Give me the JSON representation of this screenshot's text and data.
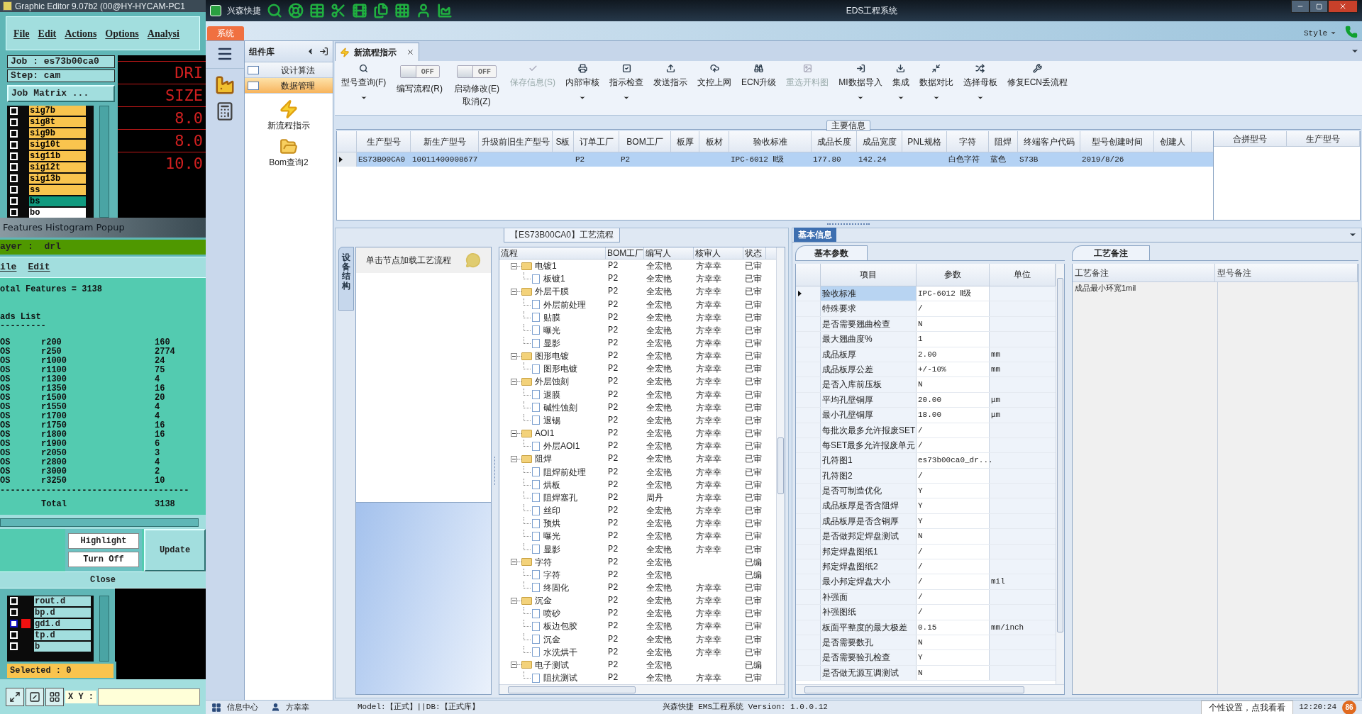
{
  "cam_editor": {
    "title": "Graphic Editor 9.07b2 (00@HY-HYCAM-PC1",
    "menu": [
      "File",
      "Edit",
      "Actions",
      "Options",
      "Analysi"
    ],
    "job": "Job : es73b00ca0",
    "step": "Step: cam",
    "job_matrix_button": "Job Matrix ...",
    "layers": [
      {
        "name": "sig7b",
        "color": "#f9c44e",
        "checked": false
      },
      {
        "name": "sig8t",
        "color": "#f9c44e",
        "checked": false
      },
      {
        "name": "sig9b",
        "color": "#f9c44e",
        "checked": false
      },
      {
        "name": "sig10t",
        "color": "#f9c44e",
        "checked": false
      },
      {
        "name": "sig11b",
        "color": "#f9c44e",
        "checked": false
      },
      {
        "name": "sig12t",
        "color": "#f9c44e",
        "checked": false
      },
      {
        "name": "sig13b",
        "color": "#f9c44e",
        "checked": false
      },
      {
        "name": "ss",
        "color": "#f9c44e",
        "checked": false
      },
      {
        "name": "bs",
        "color": "#119a7f",
        "checked": false
      },
      {
        "name": "bo",
        "color": "#ffffff",
        "checked": false
      }
    ],
    "readouts": [
      "DRI",
      "SIZE",
      "8.0",
      "8.0",
      "10.0"
    ]
  },
  "histogram_popup": {
    "title": "Features Histogram Popup",
    "layer": "ayer :  drl",
    "menu": [
      "ile",
      "Edit"
    ],
    "total_features": "otal Features = 3138",
    "list_title": "ads List",
    "rule": "---------",
    "rows": [
      [
        "OS",
        "r200",
        "160"
      ],
      [
        "OS",
        "r250",
        "2774"
      ],
      [
        "OS",
        "r1000",
        "24"
      ],
      [
        "OS",
        "r1100",
        "75"
      ],
      [
        "OS",
        "r1300",
        "4"
      ],
      [
        "OS",
        "r1350",
        "16"
      ],
      [
        "OS",
        "r1500",
        "20"
      ],
      [
        "OS",
        "r1550",
        "4"
      ],
      [
        "OS",
        "r1700",
        "4"
      ],
      [
        "OS",
        "r1750",
        "16"
      ],
      [
        "OS",
        "r1800",
        "16"
      ],
      [
        "OS",
        "r1900",
        "6"
      ],
      [
        "OS",
        "r2050",
        "3"
      ],
      [
        "OS",
        "r2800",
        "4"
      ],
      [
        "OS",
        "r3000",
        "2"
      ],
      [
        "OS",
        "r3250",
        "10"
      ]
    ],
    "total_rule": "-------------------------------------",
    "total_label": "Total",
    "total_value": "3138",
    "buttons": [
      "Highlight",
      "Turn Off"
    ],
    "update_button": "Update",
    "close_button": "Close"
  },
  "layer_list": {
    "layers": [
      {
        "name": "rout.d",
        "active": false,
        "checked": false
      },
      {
        "name": "bp.d",
        "active": false,
        "checked": false
      },
      {
        "name": "gd1.d",
        "active": true,
        "checked": false
      },
      {
        "name": "tp.d",
        "active": false,
        "checked": false
      },
      {
        "name": "b",
        "active": false,
        "checked": false
      }
    ],
    "selected": "Selected : 0",
    "xy_label": "X Y :"
  },
  "app": {
    "brand": "兴森快捷",
    "title": "EDS工程系统",
    "ribbon_tab": "系统",
    "style_menu": "Style"
  },
  "component_panel": {
    "title": "组件库",
    "categories": [
      {
        "label": "设计算法",
        "selected": false
      },
      {
        "label": "数据管理",
        "selected": true
      }
    ],
    "tools": [
      "新流程指示",
      "Bom查询2"
    ]
  },
  "document_tab": {
    "label": "新流程指示"
  },
  "toolbar": [
    {
      "kind": "button",
      "label": "型号查询(F)",
      "dropdown": true,
      "disabled": false
    },
    {
      "kind": "toggle",
      "label": "编写流程(R)",
      "state": "OFF",
      "on": false
    },
    {
      "kind": "toggle",
      "label": "启动修改(E)",
      "sublabel": "取消(Z)",
      "state": "OFF",
      "on": false
    },
    {
      "kind": "button",
      "label": "保存信息(S)",
      "dropdown": false,
      "disabled": true
    },
    {
      "kind": "button",
      "label": "内部审核",
      "dropdown": true,
      "disabled": false
    },
    {
      "kind": "button",
      "label": "指示检查",
      "dropdown": true,
      "disabled": false
    },
    {
      "kind": "button",
      "label": "发送指示",
      "dropdown": false,
      "disabled": false
    },
    {
      "kind": "button",
      "label": "文控上网",
      "dropdown": false,
      "disabled": false
    },
    {
      "kind": "button",
      "label": "ECN升级",
      "dropdown": false,
      "disabled": false
    },
    {
      "kind": "button",
      "label": "重选开料图",
      "dropdown": false,
      "disabled": true
    },
    {
      "kind": "button",
      "label": "MI数据导入",
      "dropdown": true,
      "disabled": false
    },
    {
      "kind": "button",
      "label": "集成",
      "dropdown": true,
      "disabled": false
    },
    {
      "kind": "button",
      "label": "数据对比",
      "dropdown": true,
      "disabled": false
    },
    {
      "kind": "button",
      "label": "选择母板",
      "dropdown": true,
      "disabled": false
    },
    {
      "kind": "button",
      "label": "修复ECN丢流程",
      "dropdown": false,
      "disabled": false
    }
  ],
  "main_info": {
    "title": "主要信息",
    "columns": [
      "生产型号",
      "新生产型号",
      "升级前旧生产型号",
      "S板",
      "订单工厂",
      "BOM工厂",
      "板厚",
      "板材",
      "验收标准",
      "成品长度",
      "成品宽度",
      "PNL规格",
      "字符",
      "阻焊",
      "终端客户代码",
      "型号创建时间",
      "创建人"
    ],
    "rows": [
      {
        "selected": true,
        "cells": {
          "0": "ES73B00CA0",
          "1": "10011400008677",
          "4": "P2",
          "5": "P2",
          "8": "IPC-6012 Ⅱ级",
          "9": "177.80",
          "10": "142.24",
          "12": "白色字符",
          "13": "蓝色",
          "14": "S73B",
          "15": "2019/8/26"
        }
      }
    ]
  },
  "merge_grid": {
    "columns": [
      "合拼型号",
      "生产型号"
    ]
  },
  "process_flow": {
    "title": "【ES73B00CA0】工艺流程",
    "side_tab": "设备结构",
    "hint": "单击节点加载工艺流程",
    "columns": [
      "流程",
      "BOM工厂",
      "编写人",
      "核审人",
      "状态"
    ],
    "tree": [
      {
        "name": "电镀1",
        "bom": "P2",
        "writer": "全宏艳",
        "reviewer": "方幸幸",
        "status": "已审",
        "expanded": true,
        "children": [
          {
            "name": "板镀1",
            "bom": "P2",
            "writer": "全宏艳",
            "reviewer": "方幸幸",
            "status": "已审"
          }
        ]
      },
      {
        "name": "外层干膜",
        "bom": "P2",
        "writer": "全宏艳",
        "reviewer": "方幸幸",
        "status": "已审",
        "expanded": true,
        "children": [
          {
            "name": "外层前处理",
            "bom": "P2",
            "writer": "全宏艳",
            "reviewer": "方幸幸",
            "status": "已审"
          },
          {
            "name": "贴膜",
            "bom": "P2",
            "writer": "全宏艳",
            "reviewer": "方幸幸",
            "status": "已审"
          },
          {
            "name": "曝光",
            "bom": "P2",
            "writer": "全宏艳",
            "reviewer": "方幸幸",
            "status": "已审"
          },
          {
            "name": "显影",
            "bom": "P2",
            "writer": "全宏艳",
            "reviewer": "方幸幸",
            "status": "已审"
          }
        ]
      },
      {
        "name": "图形电镀",
        "bom": "P2",
        "writer": "全宏艳",
        "reviewer": "方幸幸",
        "status": "已审",
        "expanded": true,
        "children": [
          {
            "name": "图形电镀",
            "bom": "P2",
            "writer": "全宏艳",
            "reviewer": "方幸幸",
            "status": "已审"
          }
        ]
      },
      {
        "name": "外层蚀刻",
        "bom": "P2",
        "writer": "全宏艳",
        "reviewer": "方幸幸",
        "status": "已审",
        "expanded": true,
        "children": [
          {
            "name": "退膜",
            "bom": "P2",
            "writer": "全宏艳",
            "reviewer": "方幸幸",
            "status": "已审"
          },
          {
            "name": "碱性蚀刻",
            "bom": "P2",
            "writer": "全宏艳",
            "reviewer": "方幸幸",
            "status": "已审"
          },
          {
            "name": "退锡",
            "bom": "P2",
            "writer": "全宏艳",
            "reviewer": "方幸幸",
            "status": "已审"
          }
        ]
      },
      {
        "name": "AOI1",
        "bom": "P2",
        "writer": "全宏艳",
        "reviewer": "方幸幸",
        "status": "已审",
        "expanded": true,
        "children": [
          {
            "name": "外层AOI1",
            "bom": "P2",
            "writer": "全宏艳",
            "reviewer": "方幸幸",
            "status": "已审"
          }
        ]
      },
      {
        "name": "阻焊",
        "bom": "P2",
        "writer": "全宏艳",
        "reviewer": "方幸幸",
        "status": "已审",
        "expanded": true,
        "children": [
          {
            "name": "阻焊前处理",
            "bom": "P2",
            "writer": "全宏艳",
            "reviewer": "方幸幸",
            "status": "已审"
          },
          {
            "name": "烘板",
            "bom": "P2",
            "writer": "全宏艳",
            "reviewer": "方幸幸",
            "status": "已审"
          },
          {
            "name": "阻焊塞孔",
            "bom": "P2",
            "writer": "周丹",
            "reviewer": "方幸幸",
            "status": "已审"
          },
          {
            "name": "丝印",
            "bom": "P2",
            "writer": "全宏艳",
            "reviewer": "方幸幸",
            "status": "已审"
          },
          {
            "name": "预烘",
            "bom": "P2",
            "writer": "全宏艳",
            "reviewer": "方幸幸",
            "status": "已审"
          },
          {
            "name": "曝光",
            "bom": "P2",
            "writer": "全宏艳",
            "reviewer": "方幸幸",
            "status": "已审"
          },
          {
            "name": "显影",
            "bom": "P2",
            "writer": "全宏艳",
            "reviewer": "方幸幸",
            "status": "已审"
          }
        ]
      },
      {
        "name": "字符",
        "bom": "P2",
        "writer": "全宏艳",
        "status": "已编",
        "expanded": true,
        "children": [
          {
            "name": "字符",
            "bom": "P2",
            "writer": "全宏艳",
            "status": "已编"
          },
          {
            "name": "终固化",
            "bom": "P2",
            "writer": "全宏艳",
            "reviewer": "方幸幸",
            "status": "已审"
          }
        ]
      },
      {
        "name": "沉金",
        "bom": "P2",
        "writer": "全宏艳",
        "reviewer": "方幸幸",
        "status": "已审",
        "expanded": true,
        "children": [
          {
            "name": "喷砂",
            "bom": "P2",
            "writer": "全宏艳",
            "reviewer": "方幸幸",
            "status": "已审"
          },
          {
            "name": "板边包胶",
            "bom": "P2",
            "writer": "全宏艳",
            "reviewer": "方幸幸",
            "status": "已审"
          },
          {
            "name": "沉金",
            "bom": "P2",
            "writer": "全宏艳",
            "reviewer": "方幸幸",
            "status": "已审"
          },
          {
            "name": "水洗烘干",
            "bom": "P2",
            "writer": "全宏艳",
            "reviewer": "方幸幸",
            "status": "已审"
          }
        ]
      },
      {
        "name": "电子测试",
        "bom": "P2",
        "writer": "全宏艳",
        "status": "已编",
        "expanded": true,
        "children": [
          {
            "name": "阻抗测试",
            "bom": "P2",
            "writer": "全宏艳",
            "reviewer": "方幸幸",
            "status": "已审"
          }
        ]
      }
    ]
  },
  "basic_info": {
    "title": "基本信息",
    "params_tab": "基本参数",
    "columns": [
      "项目",
      "参数",
      "单位"
    ],
    "rows": [
      {
        "item": "验收标准",
        "value": "IPC-6012 Ⅱ级",
        "selected": true
      },
      {
        "item": "特殊要求",
        "value": "/",
        "selected": false
      },
      {
        "item": "是否需要翘曲检查",
        "value": "N",
        "selected": false
      },
      {
        "item": "最大翘曲度%",
        "value": "1",
        "selected": false
      },
      {
        "item": "成品板厚",
        "value": "2.00",
        "unit": "mm",
        "selected": false
      },
      {
        "item": "成品板厚公差",
        "value": "+/-10%",
        "unit": "mm",
        "selected": false
      },
      {
        "item": "是否入库前压板",
        "value": "N",
        "selected": false
      },
      {
        "item": "平均孔壁铜厚",
        "value": "20.00",
        "unit": "μm",
        "selected": false
      },
      {
        "item": "最小孔壁铜厚",
        "value": "18.00",
        "unit": "μm",
        "selected": false
      },
      {
        "item": "每批次最多允许报废SET",
        "value": "/",
        "selected": false
      },
      {
        "item": "每SET最多允许报废单元",
        "value": "/",
        "selected": false
      },
      {
        "item": "孔符图1",
        "value": "es73b00ca0_dr...",
        "selected": false
      },
      {
        "item": "孔符图2",
        "value": "/",
        "selected": false
      },
      {
        "item": "是否可制造优化",
        "value": "Y",
        "selected": false
      },
      {
        "item": "成品板厚是否含阻焊",
        "value": "Y",
        "selected": false
      },
      {
        "item": "成品板厚是否含铜厚",
        "value": "Y",
        "selected": false
      },
      {
        "item": "是否做邦定焊盘测试",
        "value": "N",
        "selected": false
      },
      {
        "item": "邦定焊盘图纸1",
        "value": "/",
        "selected": false
      },
      {
        "item": "邦定焊盘图纸2",
        "value": "/",
        "selected": false
      },
      {
        "item": "最小邦定焊盘大小",
        "value": "/",
        "unit": "mil",
        "selected": false
      },
      {
        "item": "补强面",
        "value": "/",
        "selected": false
      },
      {
        "item": "补强图纸",
        "value": "/",
        "selected": false
      },
      {
        "item": "板面平整度的最大极差",
        "value": "0.15",
        "unit": "mm/inch",
        "selected": false
      },
      {
        "item": "是否需要数孔",
        "value": "N",
        "selected": false
      },
      {
        "item": "是否需要验孔检查",
        "value": "Y",
        "selected": false
      },
      {
        "item": "是否做无源互调测试",
        "value": "N",
        "selected": false
      }
    ],
    "notes_tab": "工艺备注",
    "notes_columns": [
      "工艺备注",
      "型号备注"
    ],
    "process_notes": [
      "成品最小环宽1mil"
    ]
  },
  "status_bar": {
    "info_center": "信息中心",
    "user": "方幸幸",
    "model": "Model:【正式】||DB:【正式库】",
    "version": "兴森快捷 EMS工程系统 Version: 1.0.0.12",
    "tip": "个性设置，点我看看",
    "time": "12:20:24",
    "badge": "86"
  }
}
